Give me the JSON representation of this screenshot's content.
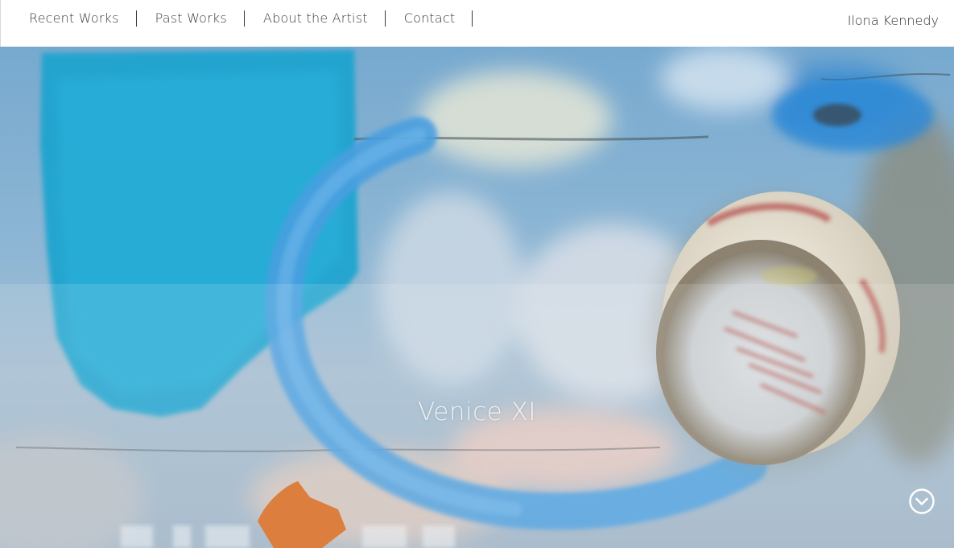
{
  "nav": {
    "items": [
      {
        "label": "Recent Works"
      },
      {
        "label": "Past Works"
      },
      {
        "label": "About the Artist"
      },
      {
        "label": "Contact"
      }
    ]
  },
  "header": {
    "artist_name": "Ilona Kennedy"
  },
  "hero": {
    "title": "Venice XI",
    "scroll_icon": "chevron-down-circle-icon"
  }
}
